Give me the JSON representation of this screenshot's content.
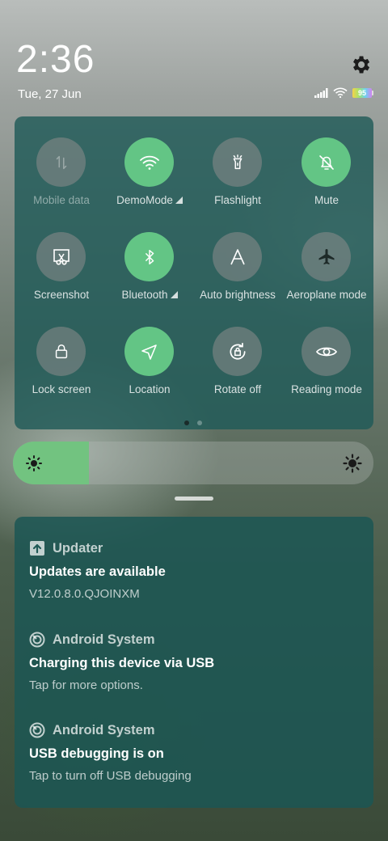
{
  "status": {
    "time": "2:36",
    "date": "Tue, 27 Jun",
    "battery": "95",
    "icons": [
      "settings-gear-icon",
      "signal-icon",
      "wifi-icon",
      "battery-icon"
    ]
  },
  "quick_settings": {
    "tiles": [
      {
        "label": "Mobile data",
        "icon": "swap-vertical-icon",
        "state": "unavailable"
      },
      {
        "label": "DemoMode",
        "icon": "wifi-icon",
        "state": "on",
        "expandable": true
      },
      {
        "label": "Flashlight",
        "icon": "flashlight-icon",
        "state": "off"
      },
      {
        "label": "Mute",
        "icon": "bell-off-icon",
        "state": "on"
      },
      {
        "label": "Screenshot",
        "icon": "scissors-icon",
        "state": "off"
      },
      {
        "label": "Bluetooth",
        "icon": "bluetooth-icon",
        "state": "on",
        "expandable": true
      },
      {
        "label": "Auto brightness",
        "icon": "letter-a-icon",
        "state": "off"
      },
      {
        "label": "Aeroplane mode",
        "icon": "airplane-icon",
        "state": "off"
      },
      {
        "label": "Lock screen",
        "icon": "lock-icon",
        "state": "off"
      },
      {
        "label": "Location",
        "icon": "location-arrow-icon",
        "state": "on"
      },
      {
        "label": "Rotate off",
        "icon": "rotate-lock-icon",
        "state": "off"
      },
      {
        "label": "Reading mode",
        "icon": "eye-icon",
        "state": "off"
      }
    ],
    "pages": 2,
    "current_page": 1
  },
  "brightness": {
    "level_fraction": 0.21
  },
  "notifications": [
    {
      "app": "Updater",
      "app_icon": "upload-arrow-icon",
      "title": "Updates are available",
      "body": "V12.0.8.0.QJOINXM"
    },
    {
      "app": "Android System",
      "app_icon": "android-system-icon",
      "title": "Charging this device via USB",
      "body": "Tap for more options."
    },
    {
      "app": "Android System",
      "app_icon": "android-system-icon",
      "title": "USB debugging is on",
      "body": "Tap to turn off USB debugging"
    }
  ],
  "colors": {
    "tile_on": "#63c585",
    "tile_off": "#8c8c8c",
    "panel": "#205a58",
    "brightness_fill": "#72c380"
  }
}
